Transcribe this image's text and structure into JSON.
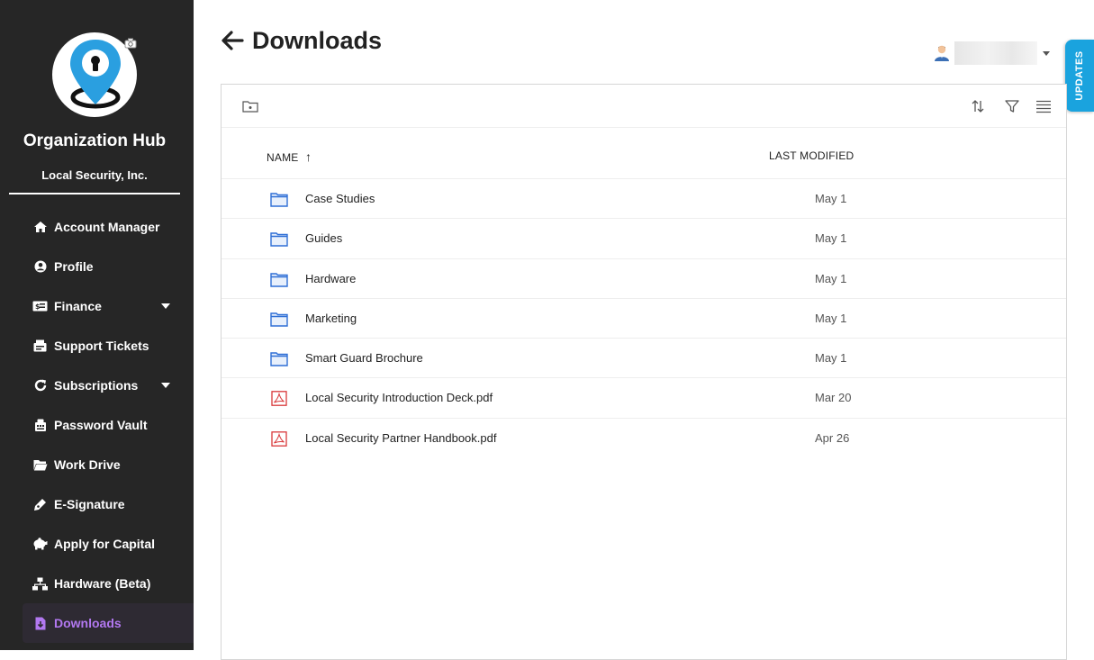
{
  "sidebar": {
    "org_title": "Organization Hub",
    "org_subtitle": "Local Security, Inc.",
    "items": [
      {
        "label": "Account Manager",
        "icon": "home-icon"
      },
      {
        "label": "Profile",
        "icon": "user-circle-icon"
      },
      {
        "label": "Finance",
        "icon": "money-bill-icon",
        "has_caret": true
      },
      {
        "label": "Support Tickets",
        "icon": "ticket-icon"
      },
      {
        "label": "Subscriptions",
        "icon": "refresh-icon",
        "has_caret": true
      },
      {
        "label": "Password Vault",
        "icon": "vault-icon"
      },
      {
        "label": "Work Drive",
        "icon": "folder-open-icon"
      },
      {
        "label": "E-Signature",
        "icon": "pen-icon"
      },
      {
        "label": "Apply for Capital",
        "icon": "piggy-bank-icon"
      },
      {
        "label": "Hardware (Beta)",
        "icon": "network-icon"
      },
      {
        "label": "Downloads",
        "icon": "file-download-icon",
        "active": true
      }
    ],
    "active_color": "#b278f0"
  },
  "header": {
    "title": "Downloads",
    "updates_label": "UPDATES"
  },
  "table": {
    "columns": {
      "name": "NAME",
      "last_modified": "LAST MODIFIED"
    },
    "sort_indicator": "↑",
    "rows": [
      {
        "name": "Case Studies",
        "modified": "May 1",
        "type": "folder"
      },
      {
        "name": "Guides",
        "modified": "May 1",
        "type": "folder"
      },
      {
        "name": "Hardware",
        "modified": "May 1",
        "type": "folder"
      },
      {
        "name": "Marketing",
        "modified": "May 1",
        "type": "folder"
      },
      {
        "name": "Smart Guard Brochure",
        "modified": "May 1",
        "type": "folder"
      },
      {
        "name": "Local Security Introduction Deck.pdf",
        "modified": "Mar 20",
        "type": "pdf"
      },
      {
        "name": "Local Security Partner Handbook.pdf",
        "modified": "Apr 26",
        "type": "pdf"
      }
    ]
  },
  "colors": {
    "sidebar_bg": "#262626",
    "folder": "#2f6fd6",
    "pdf": "#d9383a",
    "updates": "#1aa3de"
  }
}
